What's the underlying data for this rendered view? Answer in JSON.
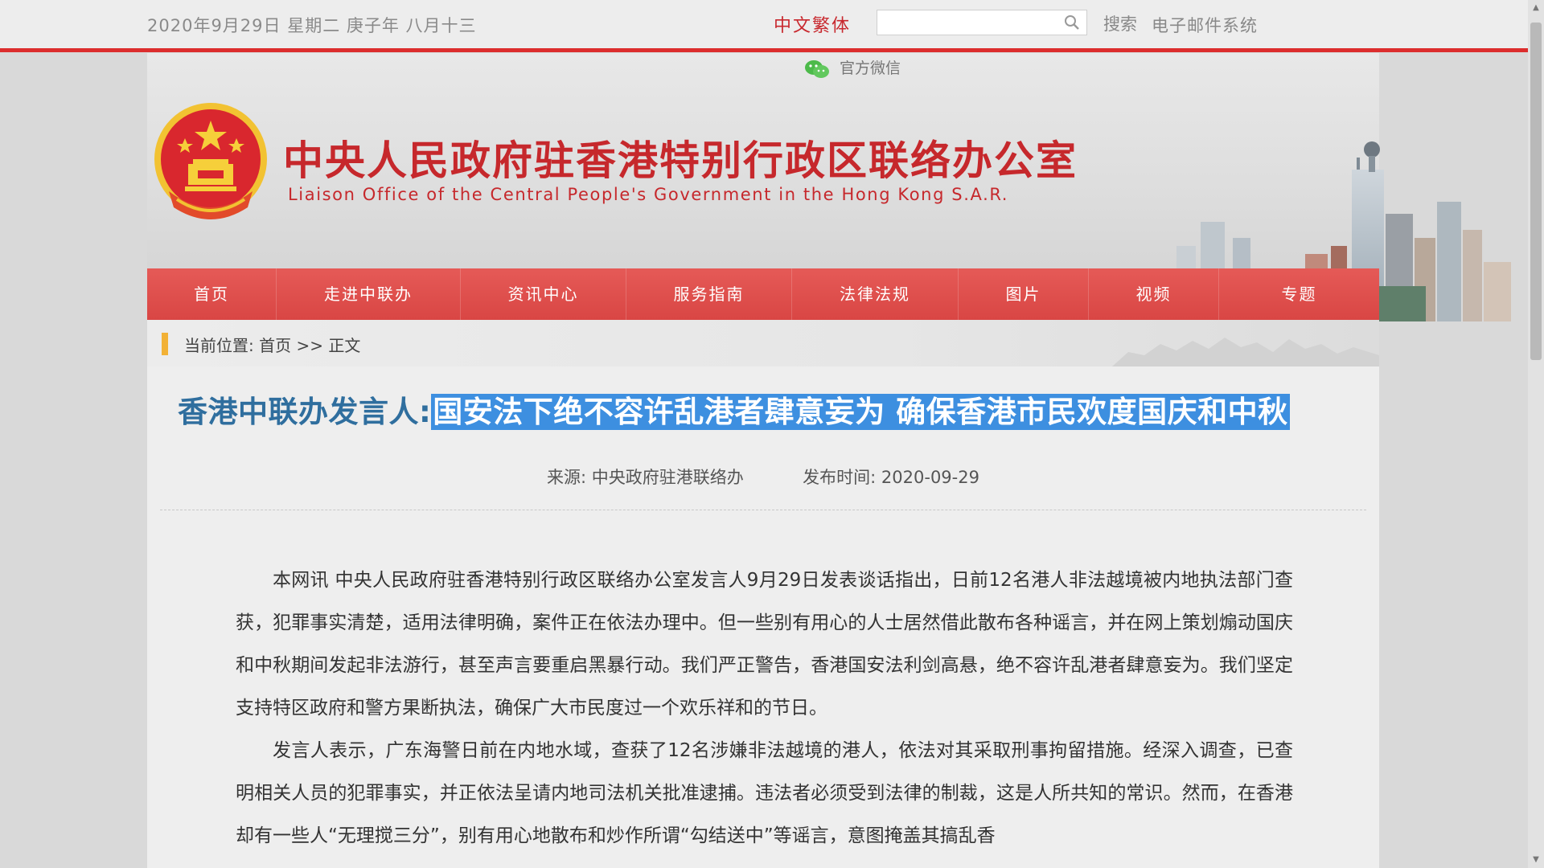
{
  "topbar": {
    "date": "2020年9月29日  星期二    庚子年  八月十三",
    "lang_switch": "中文繁体",
    "search_placeholder": "",
    "search_label": "搜索",
    "mail_label": "电子邮件系统"
  },
  "header": {
    "wechat_label": "官方微信",
    "title_cn": "中央人民政府驻香港特别行政区联络办公室",
    "title_en": "Liaison Office of the Central People's Government in the Hong Kong S.A.R."
  },
  "nav": {
    "items": [
      {
        "label": "首页"
      },
      {
        "label": "走进中联办"
      },
      {
        "label": "资讯中心"
      },
      {
        "label": "服务指南"
      },
      {
        "label": "法律法规"
      },
      {
        "label": "图片"
      },
      {
        "label": "视频"
      },
      {
        "label": "专题"
      }
    ]
  },
  "breadcrumb": {
    "prefix": "当前位置:",
    "home": "首页",
    "sep": ">>",
    "current": "正文"
  },
  "article": {
    "headline_prefix": "香港中联办发言人:",
    "headline_highlight": "国安法下绝不容许乱港者肆意妄为 确保香港市民欢度国庆和中秋",
    "source_label": "来源:",
    "source_value": "中央政府驻港联络办",
    "time_label": "发布时间:",
    "time_value": "2020-09-29",
    "paragraphs": [
      "本网讯 中央人民政府驻香港特别行政区联络办公室发言人9月29日发表谈话指出，日前12名港人非法越境被内地执法部门查获，犯罪事实清楚，适用法律明确，案件正在依法办理中。但一些别有用心的人士居然借此散布各种谣言，并在网上策划煽动国庆和中秋期间发起非法游行，甚至声言要重启黑暴行动。我们严正警告，香港国安法利剑高悬，绝不容许乱港者肆意妄为。我们坚定支持特区政府和警方果断执法，确保广大市民度过一个欢乐祥和的节日。",
      "发言人表示，广东海警日前在内地水域，查获了12名涉嫌非法越境的港人，依法对其采取刑事拘留措施。经深入调查，已查明相关人员的犯罪事实，并正依法呈请内地司法机关批准逮捕。违法者必须受到法律的制裁，这是人所共知的常识。然而，在香港却有一些人“无理搅三分”，别有用心地散布和炒作所谓“勾结送中”等谣言，意图掩盖其搞乱香"
    ]
  },
  "colors": {
    "brand_red": "#dc2d2d",
    "headline_blue": "#2f6e9e",
    "highlight_blue": "#3d8fe0",
    "crumb_marker": "#f2b136"
  }
}
